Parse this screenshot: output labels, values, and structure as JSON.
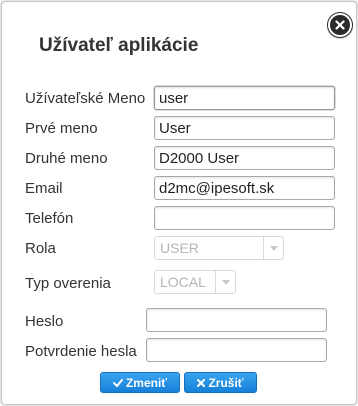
{
  "dialog": {
    "title": "Užívateľ aplikácie"
  },
  "form": {
    "username": {
      "label": "Užívateľské Meno",
      "value": "user"
    },
    "first_name": {
      "label": "Prvé meno",
      "value": "User"
    },
    "last_name": {
      "label": "Druhé meno",
      "value": "D2000 User"
    },
    "email": {
      "label": "Email",
      "value": "d2mc@ipesoft.sk"
    },
    "phone": {
      "label": "Telefón",
      "value": ""
    },
    "role": {
      "label": "Rola",
      "selected": "USER"
    },
    "auth_type": {
      "label": "Typ overenia",
      "selected": "LOCAL"
    },
    "password": {
      "label": "Heslo",
      "value": ""
    },
    "password_confirm": {
      "label": "Potvrdenie hesla",
      "value": ""
    }
  },
  "buttons": {
    "change": {
      "label": "Zmeniť",
      "icon": "check-icon"
    },
    "cancel": {
      "label": "Zrušiť",
      "icon": "x-icon"
    }
  },
  "colors": {
    "button_blue": "#1f8ee6",
    "text": "#333333",
    "close_button": "#2a2a2a"
  }
}
